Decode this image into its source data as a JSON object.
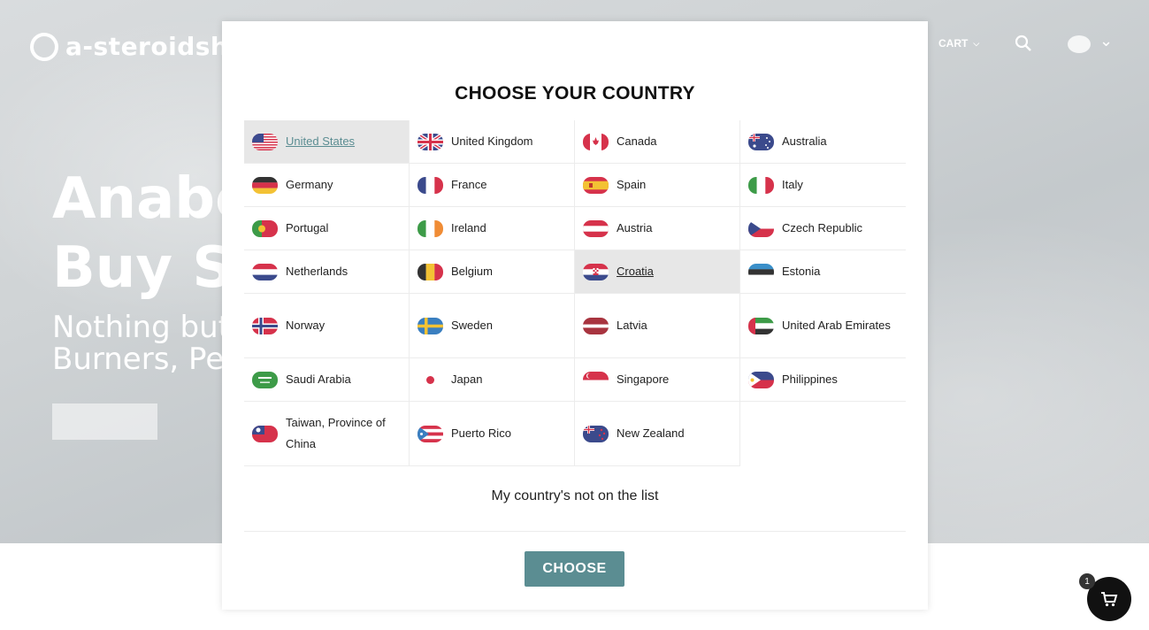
{
  "site": {
    "logo_text": "a-steroidsho",
    "nav_cart": "CART",
    "hero_title_line1": "Anabo",
    "hero_title_line2": "Buy St",
    "hero_sub_line1": "Nothing but",
    "hero_sub_line2": "Burners, Pep",
    "cart_badge": "1"
  },
  "modal": {
    "title": "CHOOSE YOUR COUNTRY",
    "not_listed": "My country's not on the list",
    "choose_label": "CHOOSE",
    "countries": [
      {
        "name": "United States",
        "flag": "us-flag-icon"
      },
      {
        "name": "United Kingdom",
        "flag": "uk-flag-icon"
      },
      {
        "name": "Canada",
        "flag": "canada-flag-icon"
      },
      {
        "name": "Australia",
        "flag": "australia-flag-icon"
      },
      {
        "name": "Germany",
        "flag": "germany-flag-icon"
      },
      {
        "name": "France",
        "flag": "france-flag-icon"
      },
      {
        "name": "Spain",
        "flag": "spain-flag-icon"
      },
      {
        "name": "Italy",
        "flag": "italy-flag-icon"
      },
      {
        "name": "Portugal",
        "flag": "portugal-flag-icon"
      },
      {
        "name": "Ireland",
        "flag": "ireland-flag-icon"
      },
      {
        "name": "Austria",
        "flag": "austria-flag-icon"
      },
      {
        "name": "Czech Republic",
        "flag": "czech-flag-icon"
      },
      {
        "name": "Netherlands",
        "flag": "netherlands-flag-icon"
      },
      {
        "name": "Belgium",
        "flag": "belgium-flag-icon"
      },
      {
        "name": "Croatia",
        "flag": "croatia-flag-icon"
      },
      {
        "name": "Estonia",
        "flag": "estonia-flag-icon"
      },
      {
        "name": "Norway",
        "flag": "norway-flag-icon"
      },
      {
        "name": "Sweden",
        "flag": "sweden-flag-icon"
      },
      {
        "name": "Latvia",
        "flag": "latvia-flag-icon"
      },
      {
        "name": "United Arab Emirates",
        "flag": "uae-flag-icon"
      },
      {
        "name": "Saudi Arabia",
        "flag": "saudi-flag-icon"
      },
      {
        "name": "Japan",
        "flag": "japan-flag-icon"
      },
      {
        "name": "Singapore",
        "flag": "singapore-flag-icon"
      },
      {
        "name": "Philippines",
        "flag": "philippines-flag-icon"
      },
      {
        "name": "Taiwan, Province of China",
        "flag": "taiwan-flag-icon"
      },
      {
        "name": "Puerto Rico",
        "flag": "puerto-rico-flag-icon"
      },
      {
        "name": "New Zealand",
        "flag": "new-zealand-flag-icon"
      }
    ]
  },
  "colors": {
    "accent": "#5b8d92",
    "selected_bg": "#e7e7e7"
  }
}
